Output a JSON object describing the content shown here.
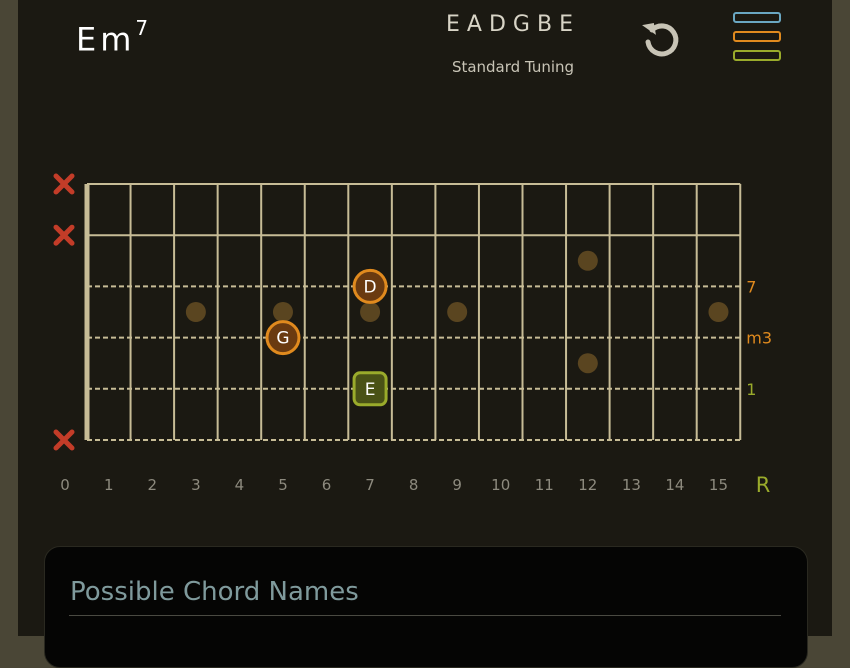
{
  "chord": {
    "root": "Em",
    "extension": "7"
  },
  "tuning": {
    "name": "EADGBE",
    "label": "Standard Tuning"
  },
  "icons": {
    "reset": "reset-icon",
    "menu": "menu-icon"
  },
  "menu_colors": [
    "#6aa7c2",
    "#e08a1e",
    "#9aab2b"
  ],
  "fretboard": {
    "fret_numbers": [
      "0",
      "1",
      "2",
      "3",
      "4",
      "5",
      "6",
      "7",
      "8",
      "9",
      "10",
      "11",
      "12",
      "13",
      "14",
      "15"
    ],
    "root_marker": "R",
    "muted_strings": [
      1,
      2,
      6
    ],
    "inlays": [
      {
        "fret": 3,
        "between": 3.5
      },
      {
        "fret": 5,
        "between": 3.5
      },
      {
        "fret": 7,
        "between": 3.5
      },
      {
        "fret": 9,
        "between": 3.5
      },
      {
        "fret": 15,
        "between": 3.5
      },
      {
        "fret": 12,
        "between": 2.5
      },
      {
        "fret": 12,
        "between": 4.5
      }
    ],
    "notes": [
      {
        "string": 3,
        "fret": 7,
        "label": "D",
        "interval": "7",
        "color": "#e08a1e"
      },
      {
        "string": 4,
        "fret": 5,
        "label": "G",
        "interval": "m3",
        "color": "#e08a1e"
      },
      {
        "string": 5,
        "fret": 7,
        "label": "E",
        "interval": "1",
        "color": "#9aab2b"
      }
    ],
    "colors": {
      "fret": "#c7bc96",
      "mute": "#c33c28",
      "inlay": "#5a4520",
      "fret_num": "#8d8a7e",
      "root": "#9aab2b"
    }
  },
  "panel": {
    "title": "Possible Chord Names"
  }
}
